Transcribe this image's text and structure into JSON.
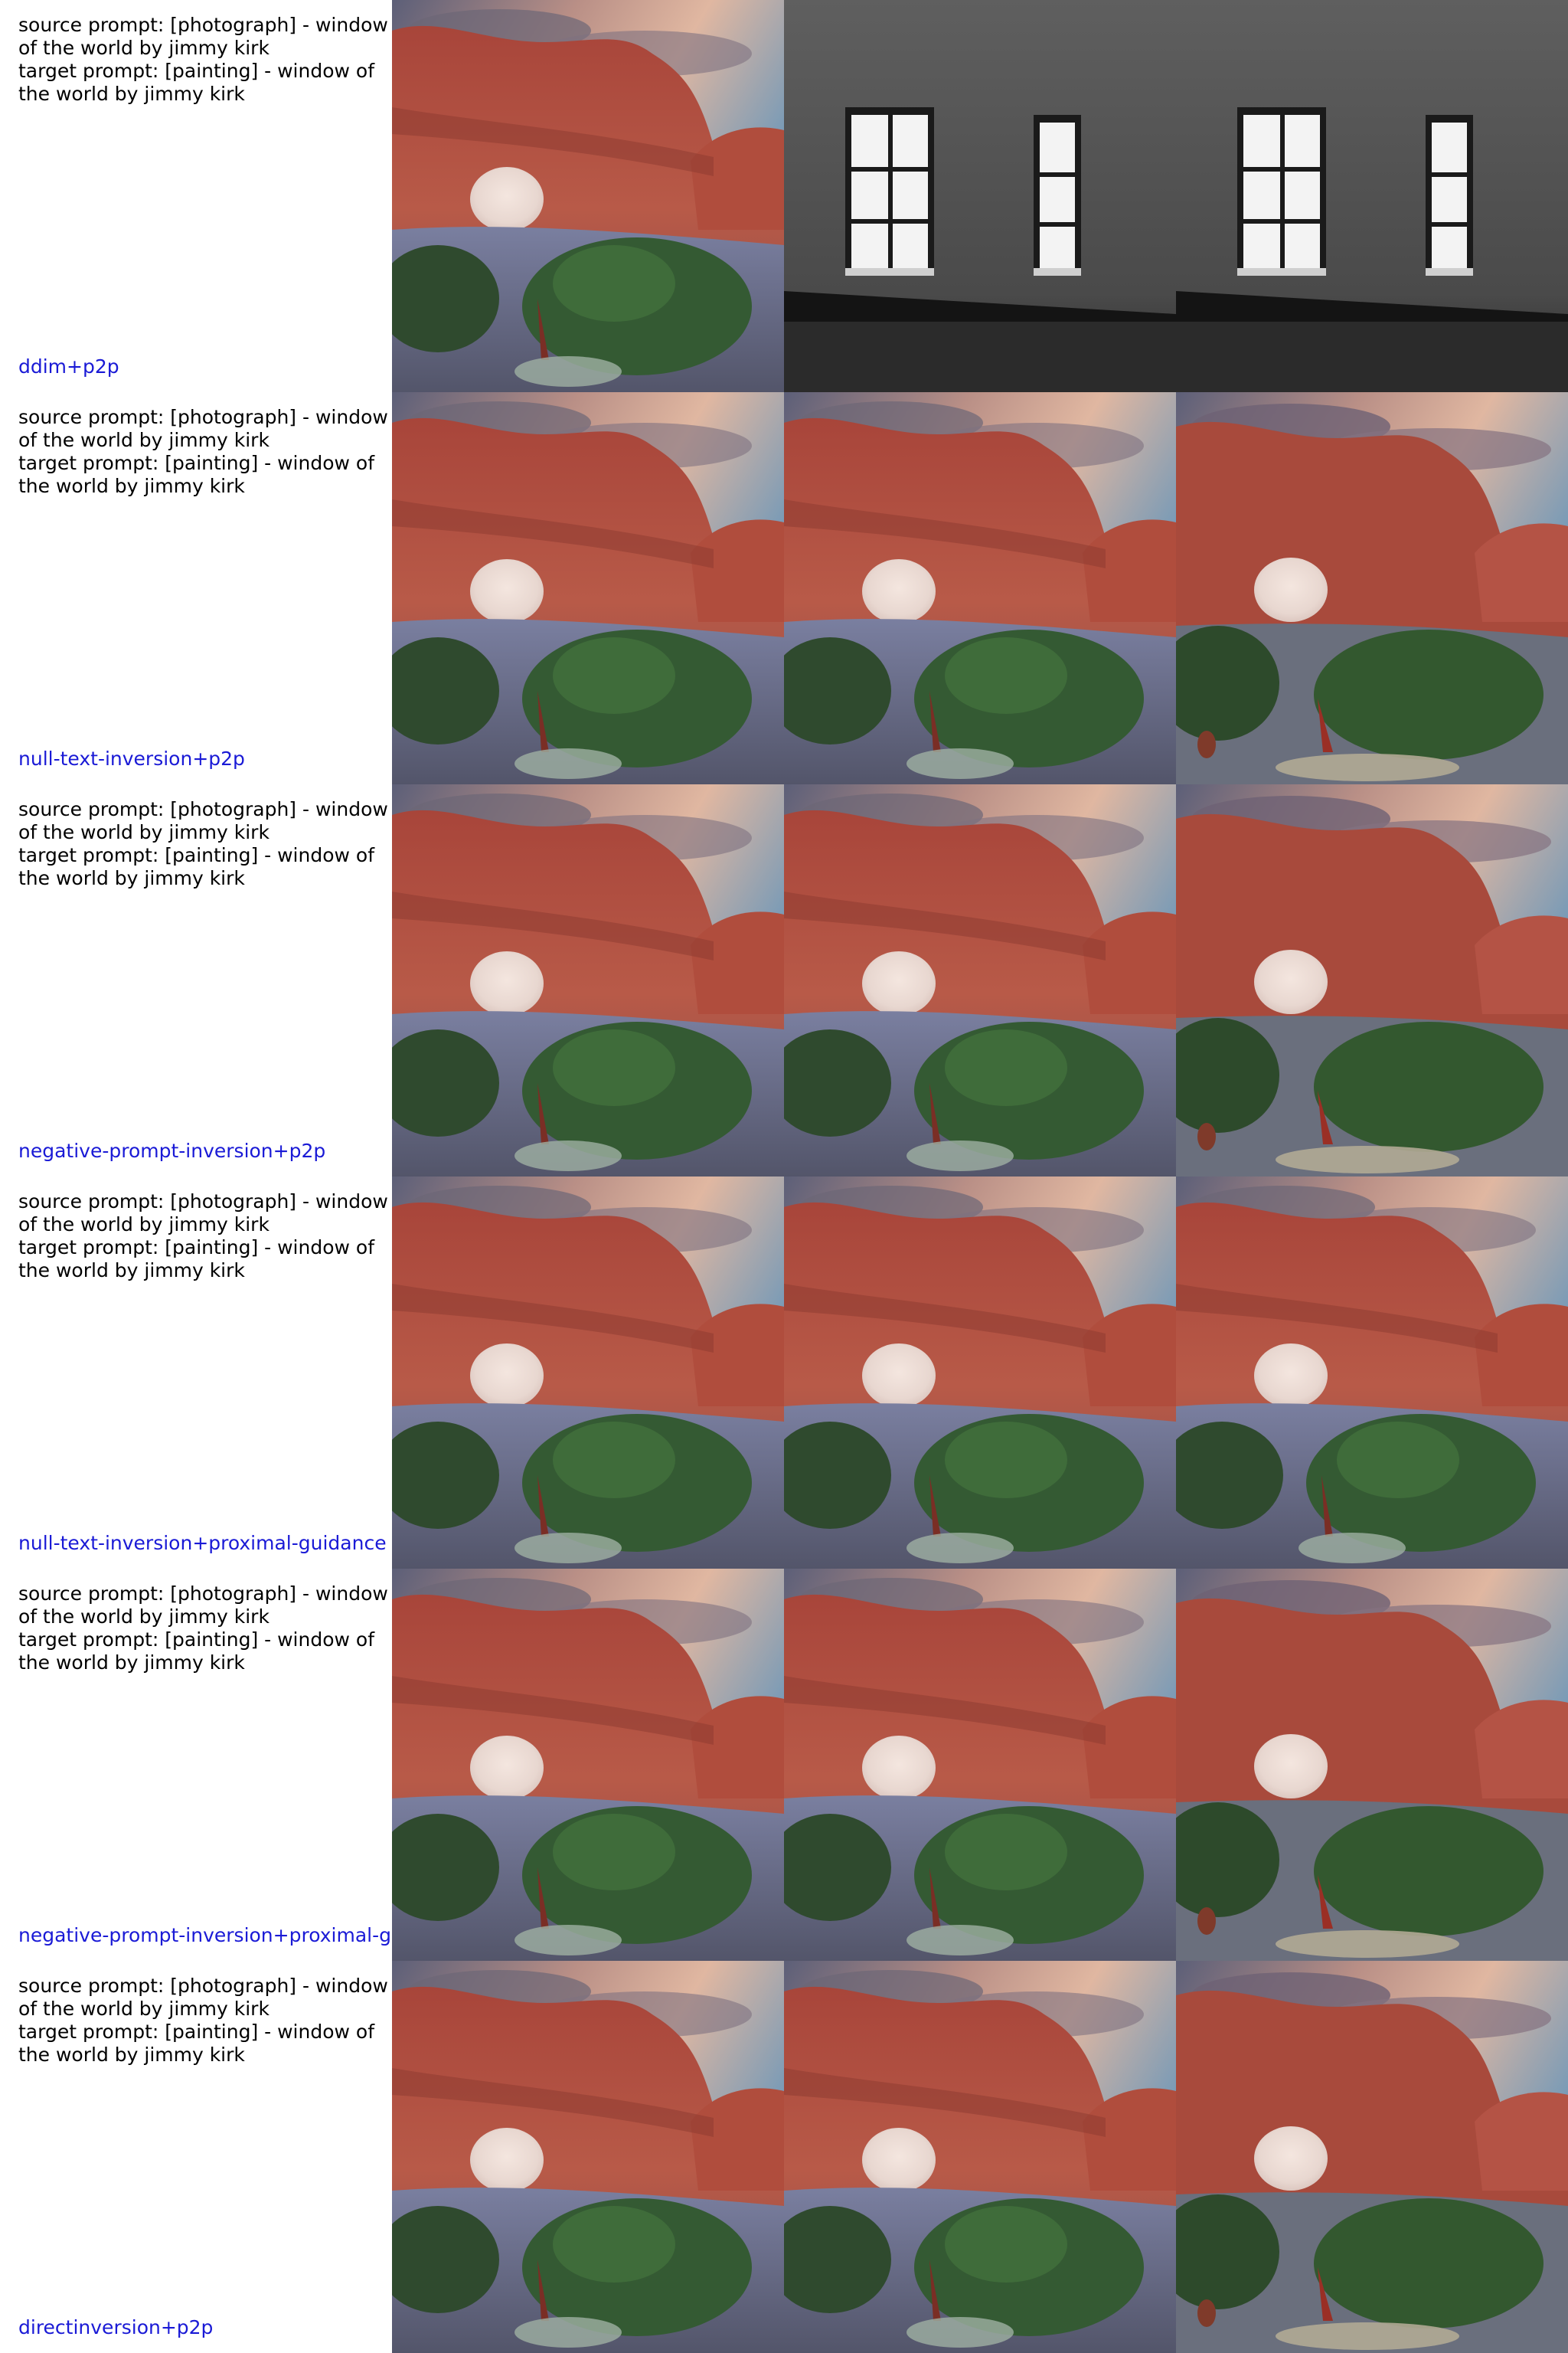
{
  "rows": [
    {
      "source_prompt": "source prompt: [photograph] - window of the world by jimmy kirk",
      "target_prompt": "target prompt: [painting] - window of the world by jimmy kirk",
      "method": "ddim+p2p",
      "images": [
        "red-rock-arch",
        "gray-wall-windows",
        "gray-wall-windows"
      ]
    },
    {
      "source_prompt": "source prompt: [photograph] - window of the world by jimmy kirk",
      "target_prompt": "target prompt: [painting] - window of the world by jimmy kirk",
      "method": "null-text-inversion+p2p",
      "images": [
        "red-rock-arch",
        "red-rock-arch",
        "red-rock-arch-painting"
      ]
    },
    {
      "source_prompt": "source prompt: [photograph] - window of the world by jimmy kirk",
      "target_prompt": "target prompt: [painting] - window of the world by jimmy kirk",
      "method": "negative-prompt-inversion+p2p",
      "images": [
        "red-rock-arch",
        "red-rock-arch",
        "red-rock-arch-painting"
      ]
    },
    {
      "source_prompt": "source prompt: [photograph] - window of the world by jimmy kirk",
      "target_prompt": "target prompt: [painting] - window of the world by jimmy kirk",
      "method": "null-text-inversion+proximal-guidance",
      "images": [
        "red-rock-arch",
        "red-rock-arch",
        "red-rock-arch"
      ]
    },
    {
      "source_prompt": "source prompt: [photograph] - window of the world by jimmy kirk",
      "target_prompt": "target prompt: [painting] - window of the world by jimmy kirk",
      "method": "negative-prompt-inversion+proximal-g",
      "images": [
        "red-rock-arch",
        "red-rock-arch",
        "red-rock-arch-painting"
      ]
    },
    {
      "source_prompt": "source prompt: [photograph] - window of the world by jimmy kirk",
      "target_prompt": "target prompt: [painting] - window of the world by jimmy kirk",
      "method": "directinversion+p2p",
      "images": [
        "red-rock-arch",
        "red-rock-arch",
        "red-rock-arch-painting"
      ]
    }
  ]
}
